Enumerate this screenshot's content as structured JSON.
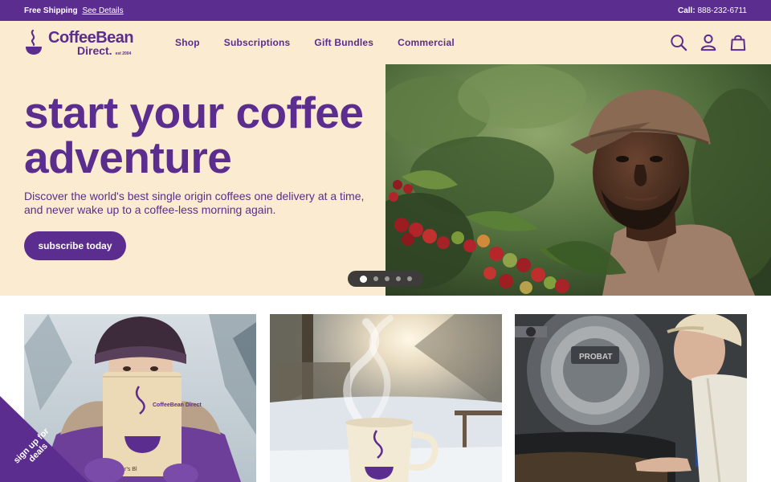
{
  "promo": {
    "shipping_text": "Free Shipping",
    "details_link": "See Details",
    "call_label": "Call:",
    "phone": "888-232-6711"
  },
  "header": {
    "logo_line1": "CoffeeBean",
    "logo_line2": "Direct.",
    "logo_est": "est 2004",
    "nav": [
      "Shop",
      "Subscriptions",
      "Gift Bundles",
      "Commercial"
    ],
    "icons": [
      "search-icon",
      "account-icon",
      "cart-icon"
    ]
  },
  "hero": {
    "title": "start your coffee adventure",
    "subtitle": "Discover the world's best single origin coffees one delivery at a time, and never wake up to a coffee-less morning again.",
    "cta": "subscribe today",
    "slides_total": 5,
    "active_slide": 1
  },
  "cards": {
    "card1_bag_brand": "CoffeeBean Direct",
    "card1_bag_label": "Roaster's Bl"
  },
  "badge": {
    "text": "sign up for deals"
  },
  "colors": {
    "brand_purple": "#5b2d8e",
    "cream": "#fbebd0",
    "white": "#ffffff"
  }
}
